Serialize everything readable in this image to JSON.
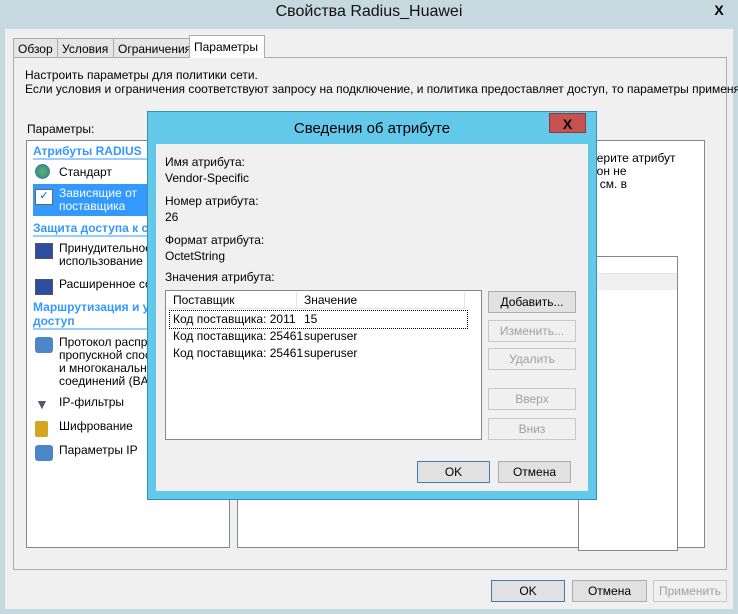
{
  "window": {
    "title": "Свойства Radius_Huawei",
    "close": "X"
  },
  "tabs": [
    {
      "label": "Обзор"
    },
    {
      "label": "Условия"
    },
    {
      "label": "Ограничения"
    },
    {
      "label": "Параметры"
    }
  ],
  "description": [
    "Настроить параметры для политики сети.",
    "Если условия и ограничения соответствуют запросу на подключение, и политика предоставляет доступ, то параметры применяются."
  ],
  "settings_label": "Параметры:",
  "sidebar": {
    "group1": "Атрибуты RADIUS",
    "standard": "Стандарт",
    "vendor": [
      "Зависящие от",
      "поставщика"
    ],
    "group2": "Защита доступа к сети",
    "nap": [
      "Принудительное",
      "использование NAP"
    ],
    "extended": "Расширенное состояние",
    "group3": [
      "Маршрутизация и удаленный",
      "доступ"
    ],
    "bap": [
      "Протокол распределения",
      "пропускной способности",
      "и многоканальных",
      "соединений (BAP)"
    ],
    "ipfilters": "IP-фильтры",
    "encryption": "Шифрование",
    "ipsettings": "Параметры IP"
  },
  "right_text": [
    "берите атрибут",
    ", он не",
    "в см. в"
  ],
  "buttons": {
    "ok": "OK",
    "cancel": "Отмена",
    "apply": "Применить"
  },
  "dialog": {
    "title": "Сведения об атрибуте",
    "close": "X",
    "name_label": "Имя атрибута:",
    "name_value": "Vendor-Specific",
    "number_label": "Номер атрибута:",
    "number_value": "26",
    "format_label": "Формат атрибута:",
    "format_value": "OctetString",
    "values_label": "Значения атрибута:",
    "columns": [
      "Поставщик",
      "Значение"
    ],
    "rows": [
      [
        "Код поставщика: 2011",
        "15"
      ],
      [
        "Код поставщика: 25461",
        "superuser"
      ],
      [
        "Код поставщика: 25461",
        "superuser"
      ]
    ],
    "add": "Добавить...",
    "edit": "Изменить...",
    "delete": "Удалить",
    "up": "Вверх",
    "down": "Вниз",
    "ok": "OK",
    "cancel": "Отмена"
  }
}
